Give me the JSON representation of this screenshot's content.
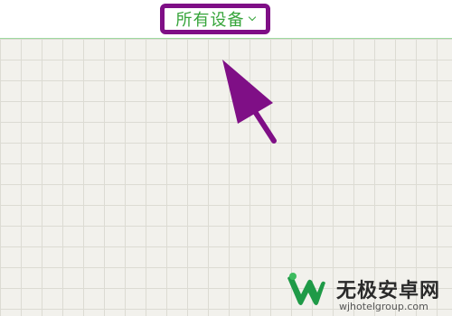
{
  "header": {
    "device_selector": {
      "label": "所有设备",
      "icon": "chevron-down-icon"
    }
  },
  "annotation": {
    "arrow_icon": "arrow-pointer-icon",
    "highlight_color": "#7f0f86"
  },
  "watermark": {
    "title": "无极安卓网",
    "url": "wjhotelgroup.com",
    "logo_icon": "wj-logo-icon"
  },
  "colors": {
    "accent_text": "#36a43a",
    "highlight": "#7f0f86",
    "grid_line": "#dcdbd3",
    "background": "#f2f1ec"
  }
}
